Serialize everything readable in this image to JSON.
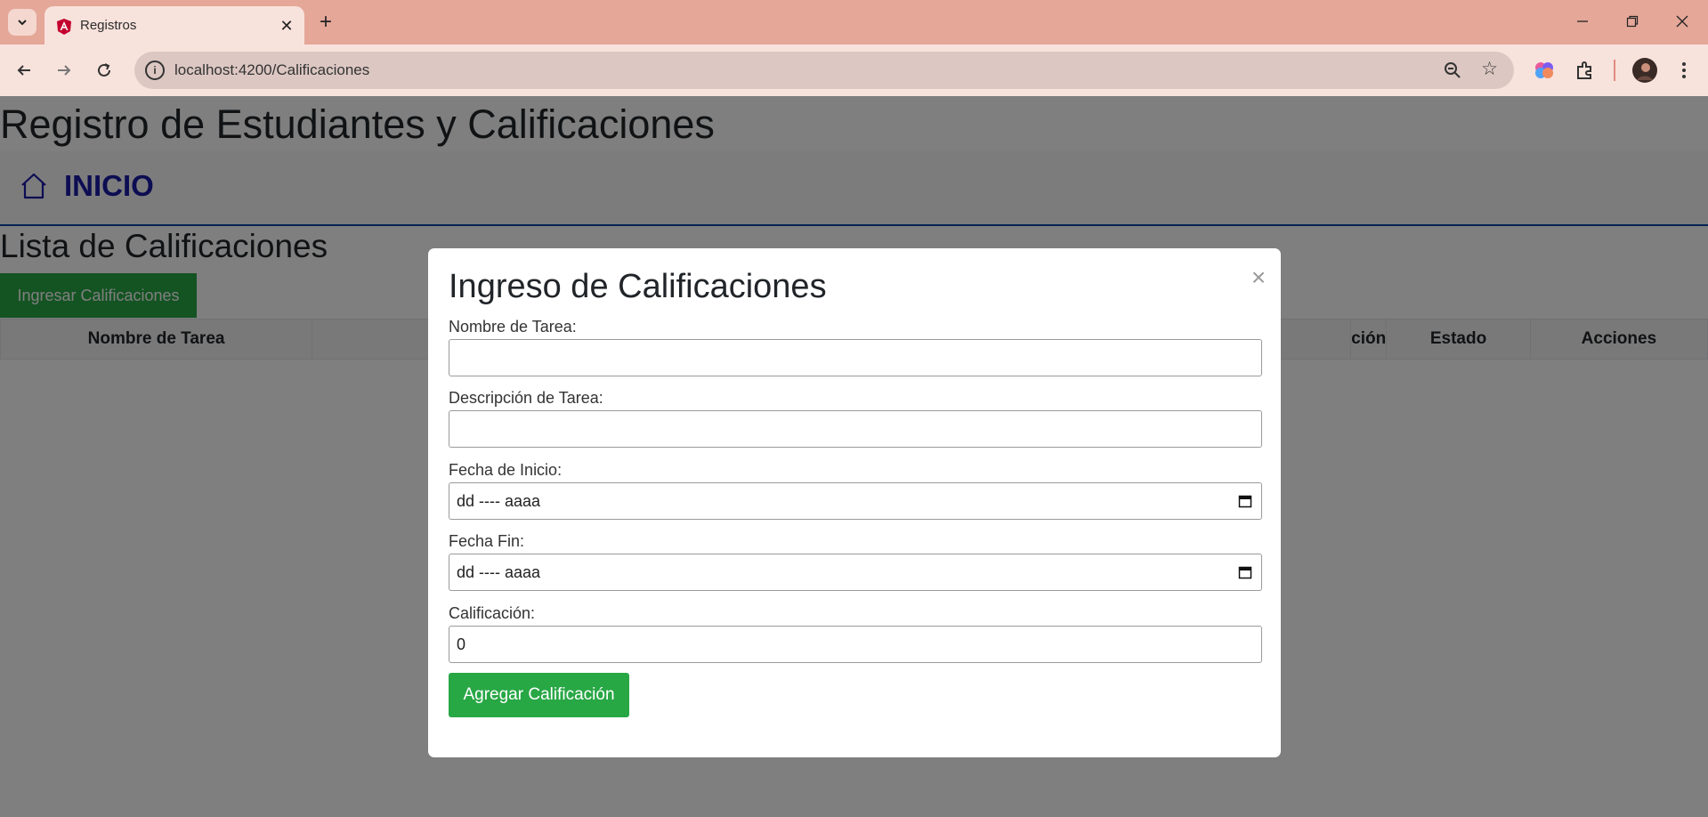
{
  "browser": {
    "tab_title": "Registros",
    "url": "localhost:4200/Calificaciones"
  },
  "page": {
    "title": "Registro de Estudiantes y Calificaciones",
    "nav_home_label": "INICIO",
    "section_title": "Lista de Calificaciones",
    "add_button_label": "Ingresar Calificaciones",
    "table_headers": [
      "Nombre de Tarea",
      "",
      "ción",
      "Estado",
      "Acciones"
    ]
  },
  "modal": {
    "title": "Ingreso de Calificaciones",
    "close_symbol": "×",
    "fields": [
      {
        "label": "Nombre de Tarea:",
        "value": ""
      },
      {
        "label": "Descripción de Tarea:",
        "value": ""
      },
      {
        "label": "Fecha de Inicio:",
        "value": "dd ---- aaaa"
      },
      {
        "label": "Fecha Fin:",
        "value": "dd ---- aaaa"
      },
      {
        "label": "Calificación:",
        "value": "0"
      }
    ],
    "submit_label": "Agregar Calificación"
  },
  "colors": {
    "tabstrip": "#e4a798",
    "success_green": "#28a745",
    "nav_link": "#1a1aa6",
    "nav_border": "#0d47a1",
    "backdrop": "rgba(0,0,0,0.5)"
  }
}
